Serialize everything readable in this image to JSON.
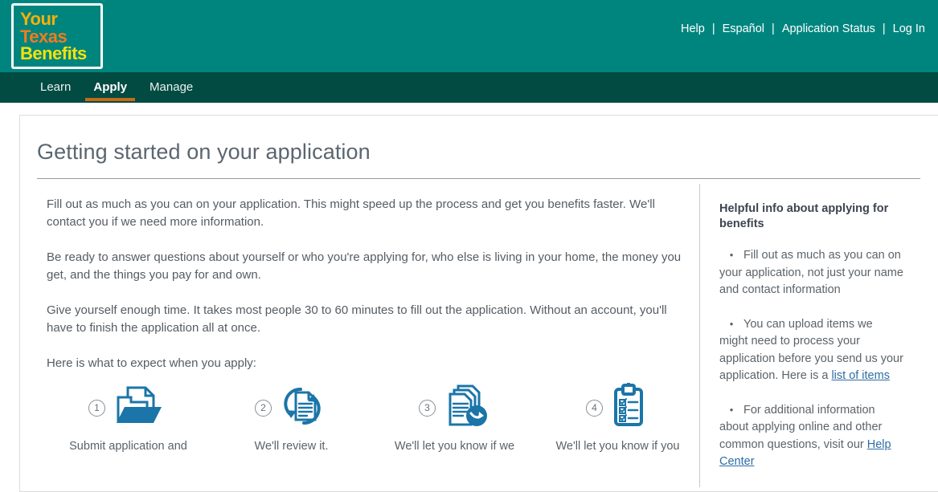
{
  "brand": {
    "logo_line1": "Your",
    "logo_line2": "Texas",
    "logo_line3": "Benefits",
    "header_color": "#00857e",
    "nav_color": "#024b43",
    "accent_color": "#c86a14",
    "icon_color": "#1b75a8",
    "link_color": "#2e6da4"
  },
  "header": {
    "links": [
      {
        "label": "Help"
      },
      {
        "label": "Español"
      },
      {
        "label": "Application Status"
      },
      {
        "label": "Log In"
      }
    ],
    "separator": "|"
  },
  "nav": {
    "items": [
      {
        "label": "Learn",
        "active": false
      },
      {
        "label": "Apply",
        "active": true
      },
      {
        "label": "Manage",
        "active": false
      }
    ]
  },
  "page": {
    "title": "Getting started on your application",
    "paragraphs": [
      "Fill out as much as you can on your application. This might speed up the process and get you benefits faster. We'll contact you if we need more information.",
      "Be ready to answer questions about yourself or who you're applying for, who else is living in your home, the money you get, and the things you pay for and own.",
      "Give yourself enough time. It takes most people 30 to 60 minutes to fill out the application. Without an account, you'll have to finish the application all at once.",
      "Here is what to expect when you apply:"
    ]
  },
  "steps": [
    {
      "number": "1",
      "icon": "document-folder-icon",
      "label": "Submit application and"
    },
    {
      "number": "2",
      "icon": "document-refresh-icon",
      "label": "We'll review it."
    },
    {
      "number": "3",
      "icon": "documents-arrow-icon",
      "label": "We'll let you know if we"
    },
    {
      "number": "4",
      "icon": "clipboard-checklist-icon",
      "label": "We'll let you know if you"
    }
  ],
  "sidebar": {
    "title": "Helpful info about applying for benefits",
    "bullet_char": "•",
    "items": [
      {
        "text_before": "Fill out as much as you can on your application, not just your name and contact information",
        "link": "",
        "text_after": ""
      },
      {
        "text_before": "You can upload items we might need to process your application before you send us your application. Here is a ",
        "link": "list of items",
        "text_after": ""
      },
      {
        "text_before": "For additional information about applying online and other common questions, visit our ",
        "link": "Help Center",
        "text_after": ""
      }
    ]
  }
}
